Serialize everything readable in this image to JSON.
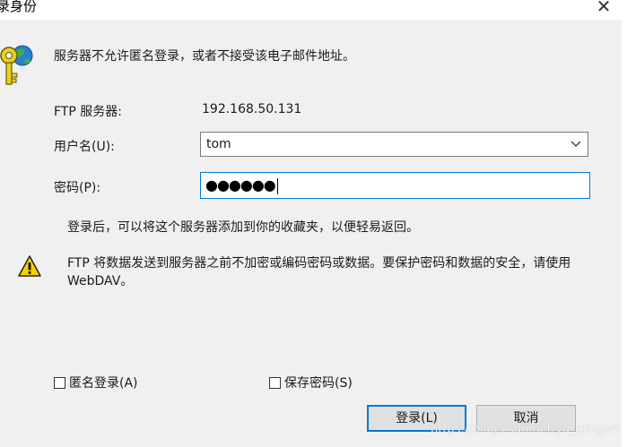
{
  "window": {
    "title": "录身份",
    "close_glyph": "✕"
  },
  "message": "服务器不允许匿名登录，或者不接受该电子邮件地址。",
  "form": {
    "server_label": "FTP 服务器:",
    "server_value": "192.168.50.131",
    "username_label": "用户名(U):",
    "username_value": "tom",
    "password_label": "密码(P):",
    "password_value": "●●●●●●"
  },
  "note": "登录后，可以将这个服务器添加到你的收藏夹，以便轻易返回。",
  "warning": "FTP 将数据发送到服务器之前不加密或编码密码或数据。要保护密码和数据的安全，请使用 WebDAV。",
  "options": {
    "anonymous_label": "匿名登录(A)",
    "save_password_label": "保存密码(S)"
  },
  "buttons": {
    "login": "登录(L)",
    "cancel": "取消"
  },
  "watermark": "https://blog.csdn.net/yu_qingjun",
  "icons": {
    "dialog": "key-globe-icon",
    "warning": "warning-triangle-icon",
    "dropdown": "chevron-down-icon"
  },
  "colors": {
    "focus_border": "#0078d7",
    "panel_bg": "#f0f0f0",
    "warning_yellow": "#f7d100"
  }
}
